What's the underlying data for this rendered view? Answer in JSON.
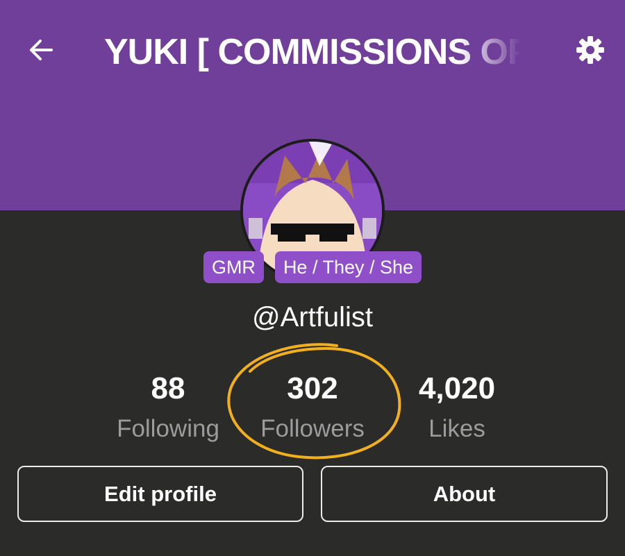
{
  "header": {
    "title": "YUKI [ COMMISSIONS OPEN ]",
    "background_color": "#6f3f99",
    "back_icon": "arrow-left-icon",
    "settings_icon": "gear-icon"
  },
  "profile": {
    "avatar_description_icon": "avatar",
    "tags": [
      "GMR",
      "He / They / She"
    ],
    "tag_color": "#8e4fc9",
    "handle": "@Artfulist"
  },
  "stats": [
    {
      "value": "88",
      "label": "Following"
    },
    {
      "value": "302",
      "label": "Followers"
    },
    {
      "value": "4,020",
      "label": "Likes"
    }
  ],
  "highlight_color": "#f2b01e",
  "buttons": {
    "edit_profile": "Edit profile",
    "about": "About"
  }
}
